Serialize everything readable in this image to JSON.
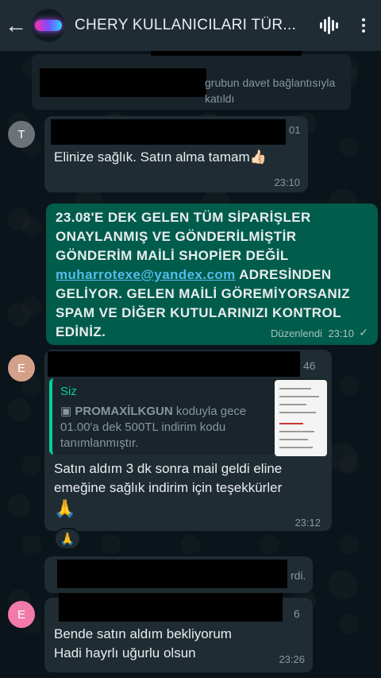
{
  "header": {
    "back_icon": "arrow-back-icon",
    "title": "CHERY KULLANICILARI TÜR...",
    "voice_icon": "audio-wave-icon",
    "menu_icon": "more-vert-icon"
  },
  "system_message": {
    "text": "grubun davet bağlantısıyla katıldı"
  },
  "messages": [
    {
      "avatar_letter": "T",
      "redacted_tail": "01",
      "text": "Elinize sağlık. Satın alma tamam👍🏻",
      "time": "23:10"
    },
    {
      "line1": "23.08'E DEK GELEN TÜM SİPARİŞLER",
      "line2": "ONAYLANMIŞ VE GÖNDERİLMİŞTİR",
      "line3": "GÖNDERİM MAİLİ SHOPİER DEĞİL",
      "email": "muharrotexe@yandex.com",
      "line4_rest": " ADRESİNDEN",
      "line5": "GELİYOR. GELEN MAİLİ GÖREMİYORSANIZ",
      "line6": "SPAM VE DİĞER KUTULARINIZI KONTROL",
      "line7": "EDİNİZ.",
      "edited_label": "Düzenlendi",
      "time": "23:10",
      "status_icon": "check-icon"
    },
    {
      "avatar_letter": "E",
      "redacted_tail": "46",
      "quote_author": "Siz",
      "quote_icon": "image-icon",
      "quote_code": "PROMAXİLKGUN",
      "quote_rest": " koduyla gece",
      "quote_line2": "01.00'a dek 500TL indirim kodu",
      "quote_line3": "tanımlanmıştır.",
      "line1": "Satın aldım 3 dk sonra mail geldi eline",
      "line2": "emeğine sağlık indirim için teşekkürler",
      "emoji": "🙏",
      "time": "23:12",
      "reaction": "🙏"
    },
    {
      "redacted_tail": "rdi."
    },
    {
      "avatar_letter": "E",
      "redacted_tail": "6",
      "line1": "Bende satın aldım bekliyorum",
      "line2": "Hadi hayrlı uğurlu olsun",
      "time": "23:26"
    }
  ],
  "colors": {
    "header": "#1f2c33",
    "background": "#0b141a",
    "incoming": "#202c33",
    "outgoing": "#005c4b",
    "link": "#53bdeb",
    "quote_accent": "#06cf9c"
  }
}
